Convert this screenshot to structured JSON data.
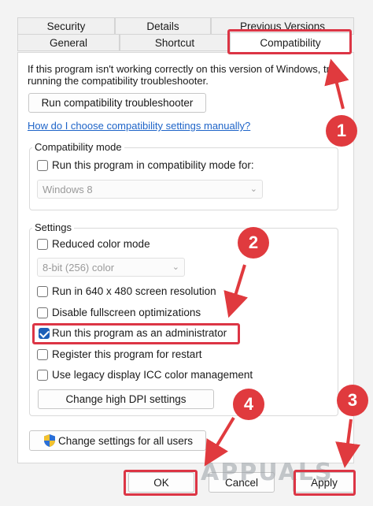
{
  "tabs_row1": [
    "Security",
    "Details",
    "Previous Versions"
  ],
  "tabs_row2": [
    "General",
    "Shortcut",
    "Compatibility"
  ],
  "intro_text_line1": "If this program isn't working correctly on this version of Windows, try",
  "intro_text_line2": "running the compatibility troubleshooter.",
  "troubleshooter_button": "Run compatibility troubleshooter",
  "help_link": "How do I choose compatibility settings manually?",
  "compat_mode": {
    "title": "Compatibility mode",
    "checkbox_label": "Run this program in compatibility mode for:",
    "checked": false,
    "select_value": "Windows 8"
  },
  "settings": {
    "title": "Settings",
    "reduced_color": {
      "label": "Reduced color mode",
      "checked": false
    },
    "color_select_value": "8-bit (256) color",
    "resolution": {
      "label": "Run in 640 x 480 screen resolution",
      "checked": false
    },
    "fullscreen": {
      "label": "Disable fullscreen optimizations",
      "checked": false
    },
    "admin": {
      "label": "Run this program as an administrator",
      "checked": true
    },
    "restart": {
      "label": "Register this program for restart",
      "checked": false
    },
    "icc": {
      "label": "Use legacy display ICC color management",
      "checked": false
    },
    "dpi_button": "Change high DPI settings"
  },
  "all_users_button": "Change settings for all users",
  "footer": {
    "ok": "OK",
    "cancel": "Cancel",
    "apply": "Apply"
  },
  "markers": [
    "1",
    "2",
    "3",
    "4"
  ],
  "watermark": "APPUALS",
  "colors": {
    "highlight": "#dc3545",
    "marker": "#e03a3e",
    "link": "#1e64c8",
    "checkbox_checked": "#1c5fb8"
  }
}
